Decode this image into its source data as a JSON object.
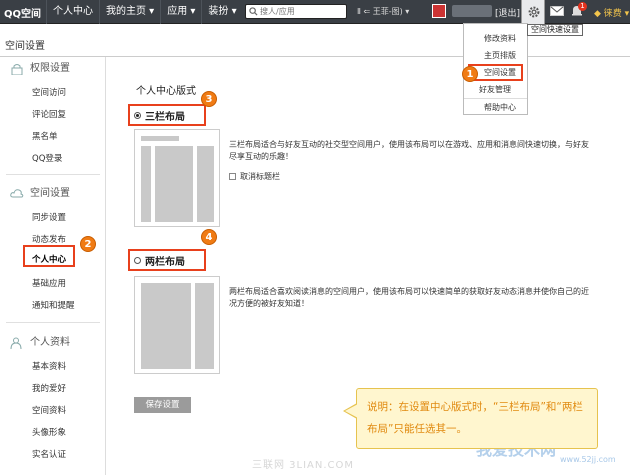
{
  "topbar": {
    "logo": "QQ空间",
    "nav": [
      "个人中心",
      "我的主页 ▾",
      "应用 ▾",
      "装扮 ▾"
    ],
    "search_placeholder": "搜人/应用",
    "music": "Ⅱ ⇐ 王菲-图) ▾",
    "logout": "[退出]",
    "badge": "1",
    "vip": "◆ 徕费 ▾"
  },
  "tooltip": "空间快速设置",
  "dropdown": {
    "items": [
      "修改资料",
      "主页排版",
      "空间设置",
      "好友管理",
      "帮助中心"
    ]
  },
  "page_title": "空间设置",
  "sidebar": {
    "sections": [
      {
        "title": "权限设置",
        "items": [
          "空间访问",
          "评论回复",
          "黑名单",
          "QQ登录"
        ]
      },
      {
        "title": "空间设置",
        "items": [
          "同步设置",
          "动态发布",
          "个人中心",
          "基础应用",
          "通知和提醒"
        ]
      },
      {
        "title": "个人资料",
        "items": [
          "基本资料",
          "我的爱好",
          "空间资料",
          "头像形象",
          "实名认证"
        ]
      }
    ]
  },
  "main": {
    "title": "个人中心版式",
    "option1": {
      "label": "三栏布局",
      "selected": true,
      "desc": "三栏布局适合与好友互动的社交型空间用户，使用该布局可以在游戏、应用和消息间快速切换，与好友尽享互动的乐趣！",
      "checkbox": "取消标题栏"
    },
    "option2": {
      "label": "两栏布局",
      "selected": false,
      "desc": "两栏布局适合喜欢阅读消息的空间用户，使用该布局可以快速简单的获取好友动态消息并使你自己的近况方便的被好友知道！"
    },
    "save_label": "保存设置"
  },
  "markers": [
    "1",
    "2",
    "3",
    "4"
  ],
  "note": "说明：在设置中心版式时，“三栏布局”和“两栏布局”只能任选其一。",
  "watermarks": {
    "site1": "三联网 3LIAN.COM",
    "site2": "我爱技术网",
    "site3": "www.52jj.com"
  },
  "colors": {
    "topbar_bg": "#3a3f45",
    "highlight": "#e8401c",
    "marker": "#f07b14",
    "note_bg": "#fff6cf",
    "note_text": "#e08a10"
  }
}
